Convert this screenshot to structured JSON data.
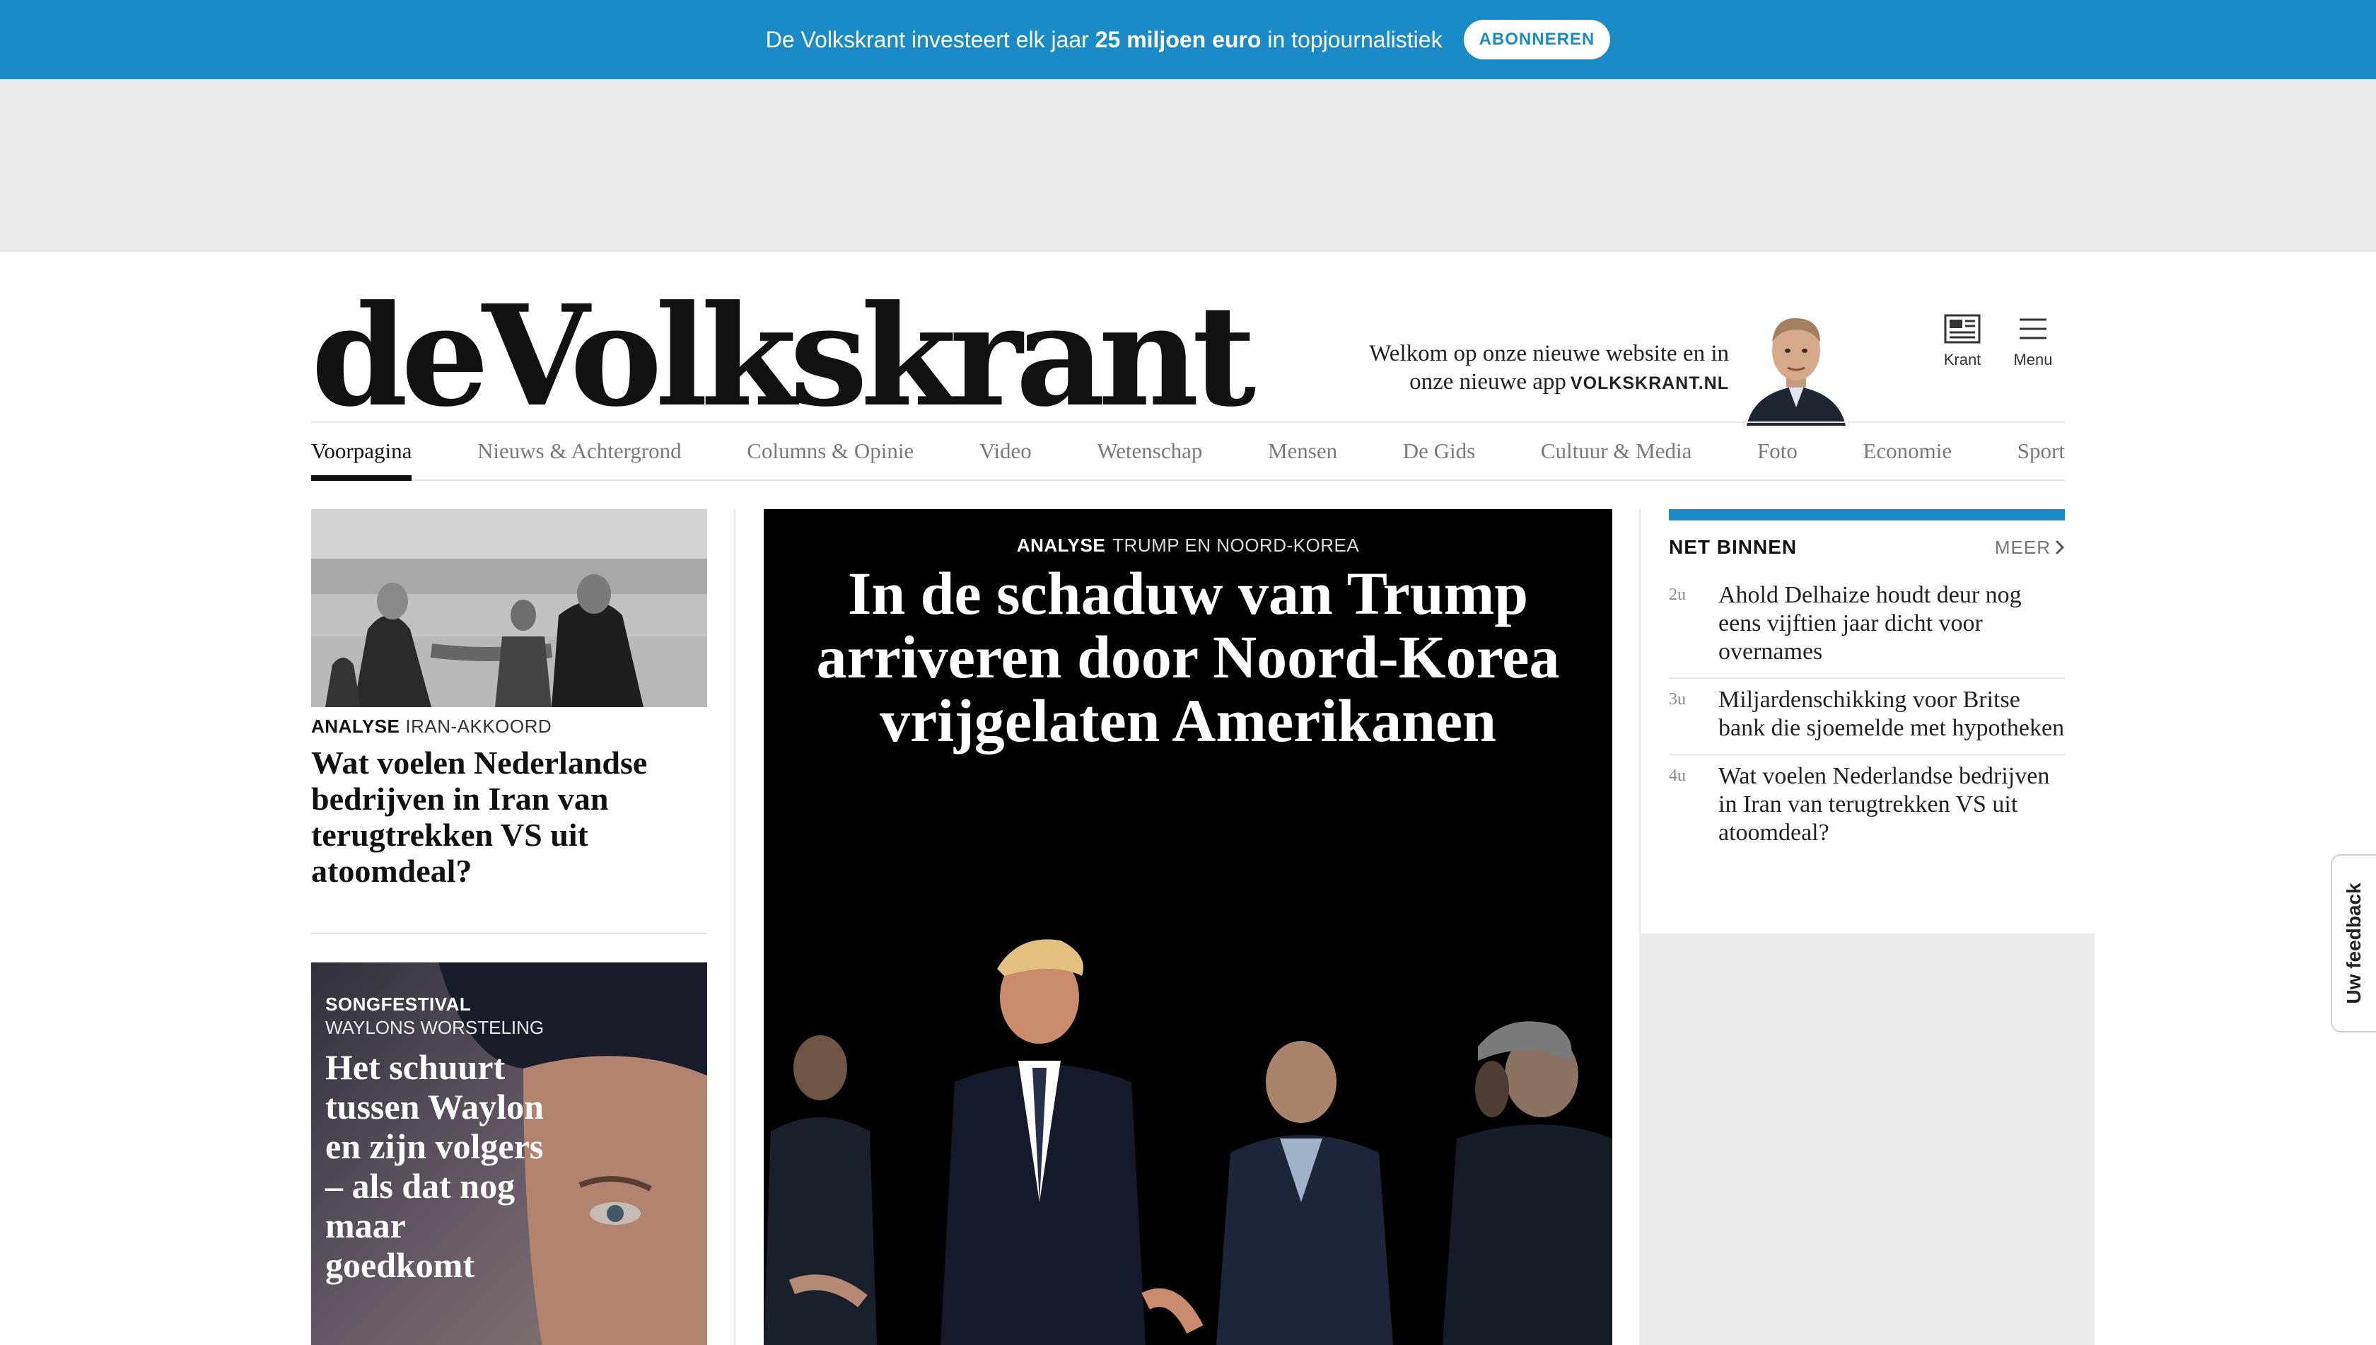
{
  "promo": {
    "text_before": "De Volkskrant investeert elk jaar ",
    "text_bold": "25 miljoen euro",
    "text_after": " in topjournalistiek",
    "button": "ABONNEREN"
  },
  "masthead": {
    "logo": "deVolkskrant",
    "welcome_line1": "Welkom op onze nieuwe website en in",
    "welcome_line2": "onze nieuwe app",
    "welcome_app": "VOLKSKRANT.NL",
    "krant_label": "Krant",
    "menu_label": "Menu"
  },
  "nav": {
    "items": [
      "Voorpagina",
      "Nieuws & Achtergrond",
      "Columns & Opinie",
      "Video",
      "Wetenschap",
      "Mensen",
      "De Gids",
      "Cultuur & Media",
      "Foto",
      "Economie",
      "Sport"
    ],
    "active": "Voorpagina"
  },
  "left": {
    "article1": {
      "kicker": "ANALYSE",
      "subkicker": "IRAN-AKKOORD",
      "head_a": "Wat voelen ",
      "head_b": "Nederlandse bedrijven",
      "head_c": " in Iran van terugtrekken VS uit atoomdeal?"
    },
    "article2": {
      "kicker": "SONGFESTIVAL",
      "subkicker": "WAYLONS WORSTELING",
      "head_a": "Het schuurt tussen ",
      "head_b": "Waylon",
      "head_c": " en zijn volgers – als dat nog maar goedkomt"
    }
  },
  "hero": {
    "kicker": "ANALYSE",
    "subkicker": "TRUMP EN NOORD-KOREA",
    "title": "In de schaduw van Trump arriveren door Noord-Korea vrijgelaten Amerikanen"
  },
  "latest": {
    "title": "NET BINNEN",
    "more": "MEER",
    "items": [
      {
        "time": "2u",
        "text": "Ahold Delhaize houdt deur nog eens vijftien jaar dicht voor overnames"
      },
      {
        "time": "3u",
        "text": "Miljardenschikking voor Britse bank die sjoemelde met hypotheken"
      },
      {
        "time": "4u",
        "text": "Wat voelen Nederlandse bedrijven in Iran van terugtrekken VS uit atoomdeal?"
      }
    ]
  },
  "feedback": "Uw feedback",
  "colors": {
    "brand_blue": "#1a8bc6",
    "ad_gray": "#e9e9e9",
    "text": "#111111"
  },
  "icons": [
    "newspaper-icon",
    "hamburger-menu-icon",
    "chevron-right-icon"
  ]
}
